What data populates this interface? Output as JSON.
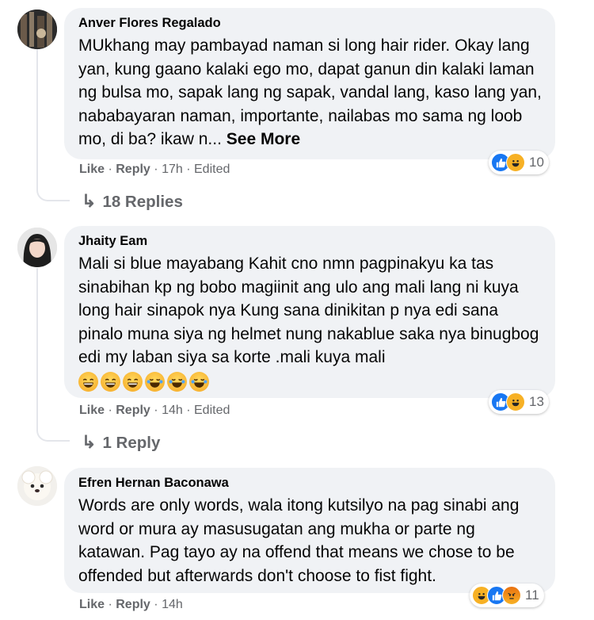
{
  "comments": [
    {
      "author": "Anver Flores Regalado",
      "text": "MUkhang may pambayad naman si long hair rider. Okay lang yan, kung gaano kalaki ego mo, dapat ganun din kalaki laman ng bulsa mo, sapak lang ng sapak, vandal lang, kaso lang yan, nababayaran naman, importante, nailabas mo sama ng loob mo, di ba? ikaw n...",
      "see_more": "See More",
      "like_label": "Like",
      "reply_label": "Reply",
      "time": "17h",
      "edited": "Edited",
      "reaction_count": "10",
      "reactions": [
        "like-icon",
        "haha-icon"
      ],
      "replies_label": "18 Replies"
    },
    {
      "author": "Jhaity Eam",
      "text": "Mali si blue mayabang Kahit cno nmn pagpinakyu ka tas sinabihan kp ng bobo magiinit ang ulo ang mali lang ni kuya long hair sinapok nya Kung sana dinikitan p nya edi sana pinalo muna siya ng helmet nung nakablue saka nya binugbog edi my laban siya sa korte .mali kuya mali",
      "emojis": [
        "grinning-sweat-emoji",
        "grinning-sweat-emoji",
        "grinning-sweat-emoji",
        "tears-of-joy-emoji",
        "tears-of-joy-emoji",
        "tears-of-joy-emoji"
      ],
      "like_label": "Like",
      "reply_label": "Reply",
      "time": "14h",
      "edited": "Edited",
      "reaction_count": "13",
      "reactions": [
        "like-icon",
        "haha-icon"
      ],
      "replies_label": "1 Reply"
    },
    {
      "author": "Efren Hernan Baconawa",
      "text": "Words are only words, wala itong kutsilyo na pag sinabi ang word or mura ay masusugatan ang mukha or parte ng katawan. Pag tayo ay na offend that means we chose to be offended but afterwards don't choose to fist fight.",
      "like_label": "Like",
      "reply_label": "Reply",
      "time": "14h",
      "reaction_count": "11",
      "reactions": [
        "haha-icon",
        "like-icon",
        "angry-icon"
      ]
    }
  ],
  "separator": "·",
  "colors": {
    "bubble": "#f0f2f5",
    "meta": "#65676b",
    "like": "#1877f2",
    "haha": "#f7b125"
  }
}
